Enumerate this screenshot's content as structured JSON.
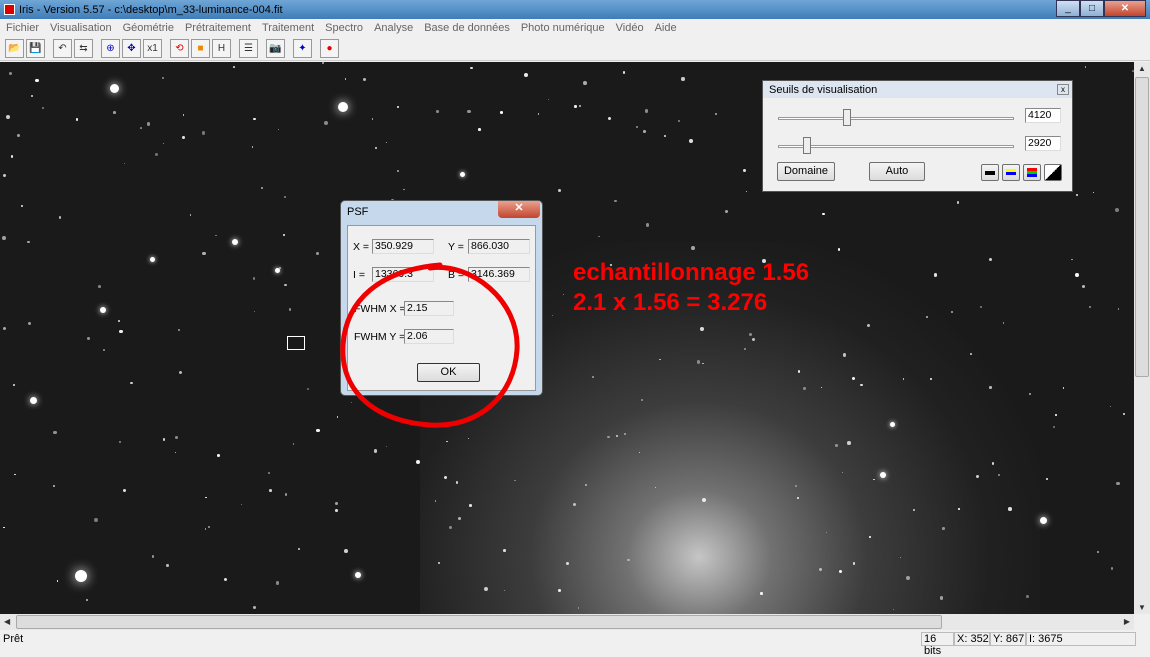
{
  "window": {
    "title": "Iris - Version 5.57 - c:\\desktop\\m_33-luminance-004.fit"
  },
  "menu": [
    "Fichier",
    "Visualisation",
    "Géométrie",
    "Prétraitement",
    "Traitement",
    "Spectro",
    "Analyse",
    "Base de données",
    "Photo numérique",
    "Vidéo",
    "Aide"
  ],
  "toolbar": [
    {
      "icon": "open-icon",
      "glyph": "📂"
    },
    {
      "icon": "save-icon",
      "glyph": "💾"
    },
    {
      "icon": "undo-icon",
      "glyph": "↶"
    },
    {
      "icon": "adjust-icon",
      "glyph": "⇆"
    },
    {
      "icon": "zoom-fit-icon",
      "glyph": "⊕"
    },
    {
      "icon": "zoom-in-icon",
      "glyph": "✥"
    },
    {
      "icon": "x1-icon",
      "glyph": "x1"
    },
    {
      "icon": "rotate-icon",
      "glyph": "⟲"
    },
    {
      "icon": "palette-icon",
      "glyph": "■"
    },
    {
      "icon": "histogram-icon",
      "glyph": "H"
    },
    {
      "icon": "list-icon",
      "glyph": "☰"
    },
    {
      "icon": "camera-icon",
      "glyph": "📷"
    },
    {
      "icon": "move-icon",
      "glyph": "✦"
    },
    {
      "icon": "record-icon",
      "glyph": "●"
    }
  ],
  "thresholds": {
    "title": "Seuils de visualisation",
    "high": "4120",
    "low": "2920",
    "high_level": 0.05,
    "low_level": 0.03,
    "domaine": "Domaine",
    "auto": "Auto"
  },
  "psf": {
    "title": "PSF",
    "x_label": "X =",
    "x": "350.929",
    "y_label": "Y =",
    "y": "866.030",
    "i_label": "I =",
    "i": "13369.3",
    "b_label": "B =",
    "b": "3146.369",
    "fwhmx_label": "FWHM X =",
    "fwhmx": "2.15",
    "fwhmy_label": "FWHM Y =",
    "fwhmy": "2.06",
    "ok": "OK"
  },
  "annotation": {
    "line1": "echantillonnage 1.56",
    "line2": "2.1 x 1.56 = 3.276",
    "color": "#ff0000"
  },
  "status": {
    "ready": "Prêt",
    "bits": "16 bits",
    "x": "X: 352",
    "y": "Y: 867",
    "i": "I: 3675"
  }
}
